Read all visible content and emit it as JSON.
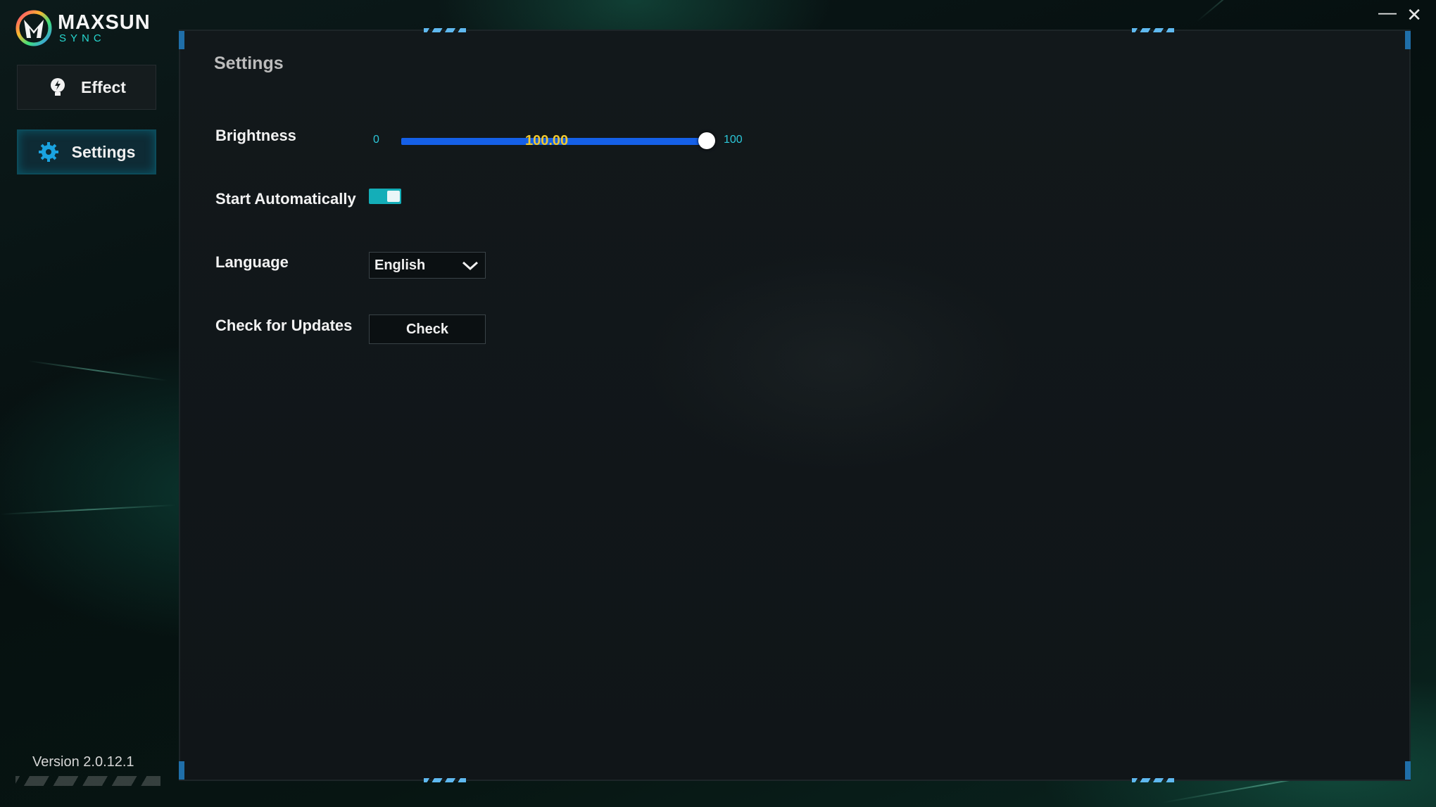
{
  "app": {
    "brand_name": "MAXSUN",
    "brand_sub": "SYNC",
    "version": "Version 2.0.12.1"
  },
  "nav": {
    "items": [
      {
        "label": "Effect",
        "icon": "bulb-icon"
      },
      {
        "label": "Settings",
        "icon": "gear-icon"
      }
    ]
  },
  "window": {
    "minimize_glyph": "—",
    "close_glyph": "✕"
  },
  "settings": {
    "title": "Settings",
    "brightness": {
      "label": "Brightness",
      "min_label": "0",
      "max_label": "100",
      "value_text": "100.00",
      "value": 100
    },
    "start_automatically": {
      "label": "Start Automatically",
      "enabled": true
    },
    "language": {
      "label": "Language",
      "selected": "English"
    },
    "updates": {
      "label": "Check for Updates",
      "button_label": "Check"
    }
  },
  "colors": {
    "accent_cyan": "#27d8d0",
    "slider_track": "#1560e8",
    "slider_value": "#f0c830",
    "toggle_on": "#14aeb8"
  }
}
